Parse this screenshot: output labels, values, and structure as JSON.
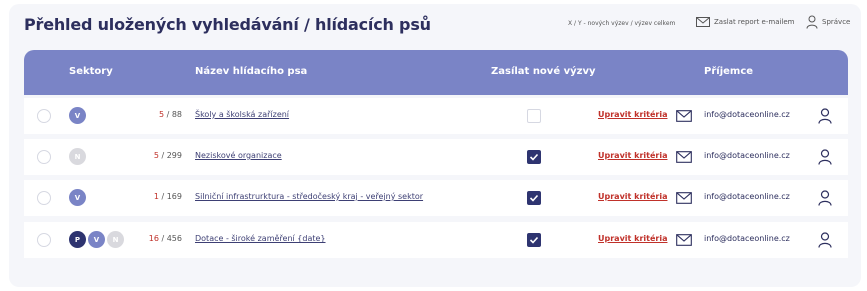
{
  "header": {
    "title": "Přehled uložených vyhledávání / hlídacích psů",
    "legend": "X / Y - nových výzev / výzev celkem",
    "send_report": "Zaslat report e-mailem",
    "admin": "Správce"
  },
  "columns": {
    "sectors": "Sektory",
    "name": "Název hlídacího psa",
    "send_new": "Zasílat nové výzvy",
    "recipient": "Příjemce"
  },
  "edit_label": "Upravit kritéria",
  "colors": {
    "accent": "#7a84c6",
    "dark": "#2e3470",
    "red": "#c0312a",
    "muted": "#d9d9de"
  },
  "rows": [
    {
      "badges": [
        {
          "letter": "V",
          "color": "#7a84c6"
        }
      ],
      "new": "5",
      "total": "88",
      "name": "Školy a školská zařízení",
      "send": false,
      "email": "info@dotaceonline.cz"
    },
    {
      "badges": [
        {
          "letter": "N",
          "color": "#d9d9de"
        }
      ],
      "new": "5",
      "total": "299",
      "name": "Neziskové organizace",
      "send": true,
      "email": "info@dotaceonline.cz"
    },
    {
      "badges": [
        {
          "letter": "V",
          "color": "#7a84c6"
        }
      ],
      "new": "1",
      "total": "169",
      "name": "Silniční infrastrurktura - středočeský kraj - veřejný sektor",
      "send": true,
      "email": "info@dotaceonline.cz"
    },
    {
      "badges": [
        {
          "letter": "P",
          "color": "#2e3470"
        },
        {
          "letter": "V",
          "color": "#7a84c6"
        },
        {
          "letter": "N",
          "color": "#d9d9de"
        }
      ],
      "new": "16",
      "total": "456",
      "name": "Dotace - široké zaměření {date}",
      "send": true,
      "email": "info@dotaceonline.cz"
    }
  ]
}
